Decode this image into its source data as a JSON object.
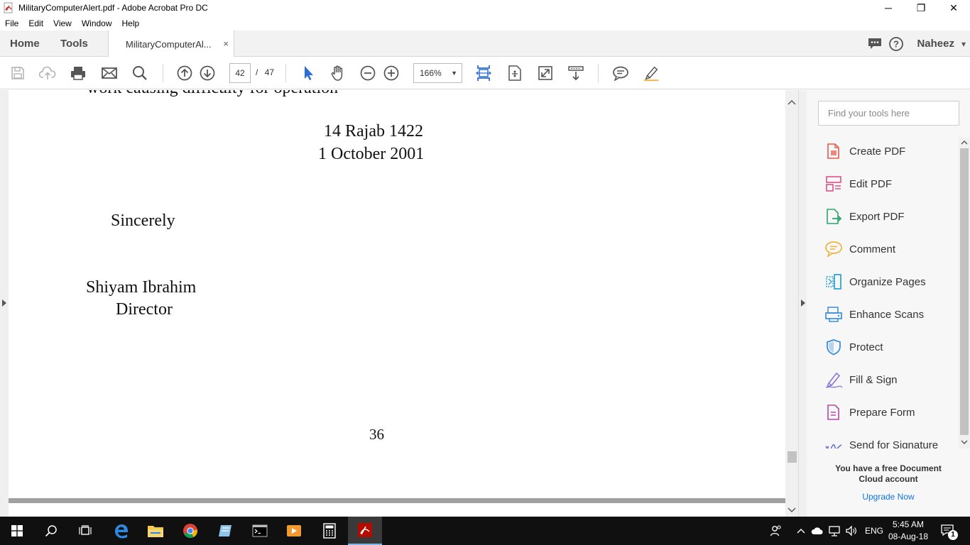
{
  "window": {
    "title": "MilitaryComputerAlert.pdf - Adobe Acrobat Pro DC",
    "minimize": "─",
    "maximize": "❐",
    "close": "✕"
  },
  "menu": [
    "File",
    "Edit",
    "View",
    "Window",
    "Help"
  ],
  "tabs": {
    "home": "Home",
    "tools": "Tools",
    "document": "MilitaryComputerAl...",
    "close": "×"
  },
  "user": {
    "name": "Naheez",
    "caret": "▾"
  },
  "toolbar": {
    "page_current": "42",
    "page_separator": "/",
    "page_total": "47",
    "zoom": "166%",
    "zoom_caret": "▼"
  },
  "document": {
    "top_partial_line": "work causing difficulty for operation",
    "date_hijri": "14 Rajab 1422",
    "date_gregorian": "1 October 2001",
    "closing": "Sincerely",
    "signer_name": "Shiyam Ibrahim",
    "signer_title": "Director",
    "page_number": "36"
  },
  "right_panel": {
    "search_placeholder": "Find your tools here",
    "tools": [
      {
        "label": "Create PDF",
        "icon": "create-pdf-icon",
        "color": "#e8584a"
      },
      {
        "label": "Edit PDF",
        "icon": "edit-pdf-icon",
        "color": "#e0508a"
      },
      {
        "label": "Export PDF",
        "icon": "export-pdf-icon",
        "color": "#2fa36b"
      },
      {
        "label": "Comment",
        "icon": "comment-icon",
        "color": "#f1b23b"
      },
      {
        "label": "Organize Pages",
        "icon": "organize-pages-icon",
        "color": "#30a6d8"
      },
      {
        "label": "Enhance Scans",
        "icon": "enhance-scans-icon",
        "color": "#3a8fd8"
      },
      {
        "label": "Protect",
        "icon": "protect-icon",
        "color": "#3a8fd8"
      },
      {
        "label": "Fill & Sign",
        "icon": "fill-sign-icon",
        "color": "#8a76d8"
      },
      {
        "label": "Prepare Form",
        "icon": "prepare-form-icon",
        "color": "#b04aa6"
      },
      {
        "label": "Send for Signature",
        "icon": "send-signature-icon",
        "color": "#6e6ed8"
      }
    ],
    "cloud_message_line1": "You have a free Document",
    "cloud_message_line2": "Cloud account",
    "upgrade_link": "Upgrade Now"
  },
  "taskbar": {
    "language": "ENG",
    "time": "5:45 AM",
    "date": "08-Aug-18",
    "notification_count": "1"
  },
  "colors": {
    "accent_blue": "#1473e6",
    "select_tool_blue": "#2c6ed5"
  }
}
